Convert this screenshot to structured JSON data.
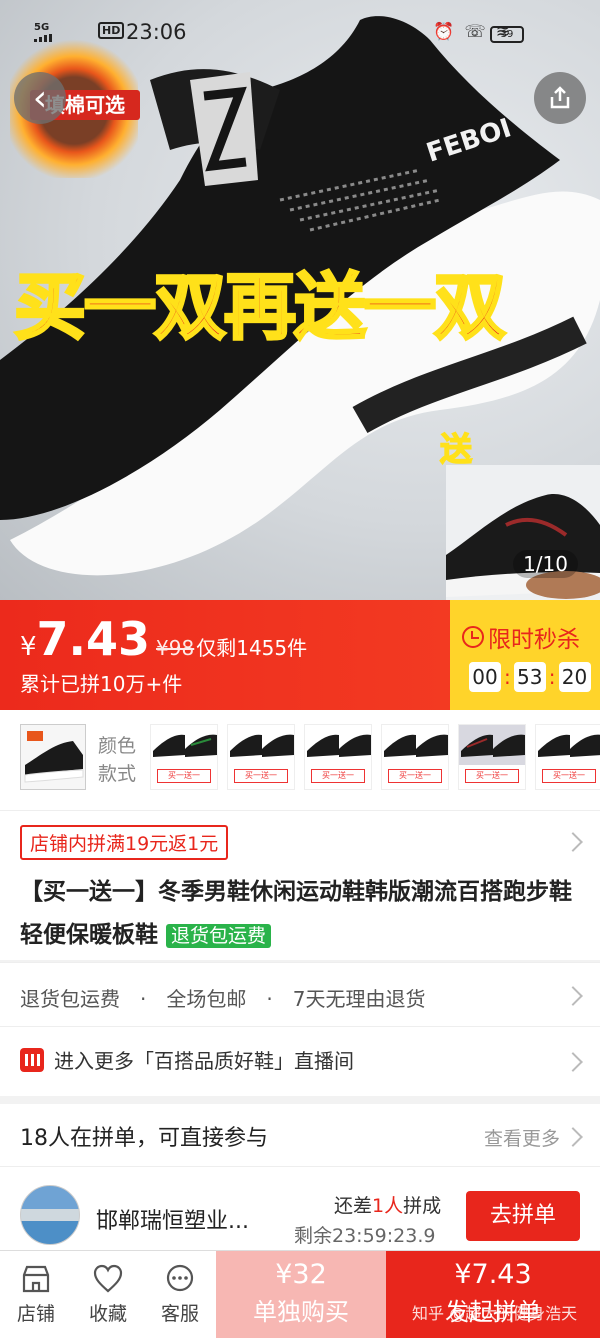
{
  "status_bar": {
    "signal": "5G",
    "hd": "HD",
    "time": "23:06",
    "battery": "39"
  },
  "hero": {
    "badge": "填棉可选",
    "promo": "买一双再送一双",
    "gift_tag": "送",
    "brand_print": "FEBOI",
    "image_counter": "1/10"
  },
  "price": {
    "currency": "¥",
    "current": "7.43",
    "original": "¥98",
    "remaining": "仅剩1455件",
    "sold": "累计已拼10万+件"
  },
  "flash_sale": {
    "title": "限时秒杀",
    "hours": "00",
    "minutes": "53",
    "seconds": "20"
  },
  "sku": {
    "label": "颜色款式",
    "main_caption": "买一双再送一双",
    "options": [
      "买一送一",
      "买一送一",
      "买一送一",
      "买一送一",
      "买一送一",
      "买一送一",
      "买一送一"
    ]
  },
  "product": {
    "coupon": "店铺内拼满19元返1元",
    "title": "【买一送一】冬季男鞋休闲运动鞋韩版潮流百搭跑步鞋轻便保暖板鞋",
    "return_tag": "退货包运费"
  },
  "services": {
    "items": [
      "退货包运费",
      "全场包邮",
      "7天无理由退货"
    ],
    "separator": "·"
  },
  "live": {
    "text": "进入更多「百搭品质好鞋」直播间"
  },
  "group": {
    "header": "18人在拼单，可直接参与",
    "more": "查看更多",
    "row": {
      "name": "邯郸瑞恒塑业...",
      "need_prefix": "还差",
      "need_count": "1人",
      "need_suffix": "拼成",
      "time_left": "剩余23:59:23.9",
      "join": "去拼单"
    }
  },
  "bottom": {
    "store": "店铺",
    "favorite": "收藏",
    "service": "客服",
    "alone_price": "¥32",
    "alone_label": "单独购买",
    "group_price": "¥7.43",
    "group_label": "发起拼单"
  },
  "watermark": "知乎 @超大的健身浩天"
}
